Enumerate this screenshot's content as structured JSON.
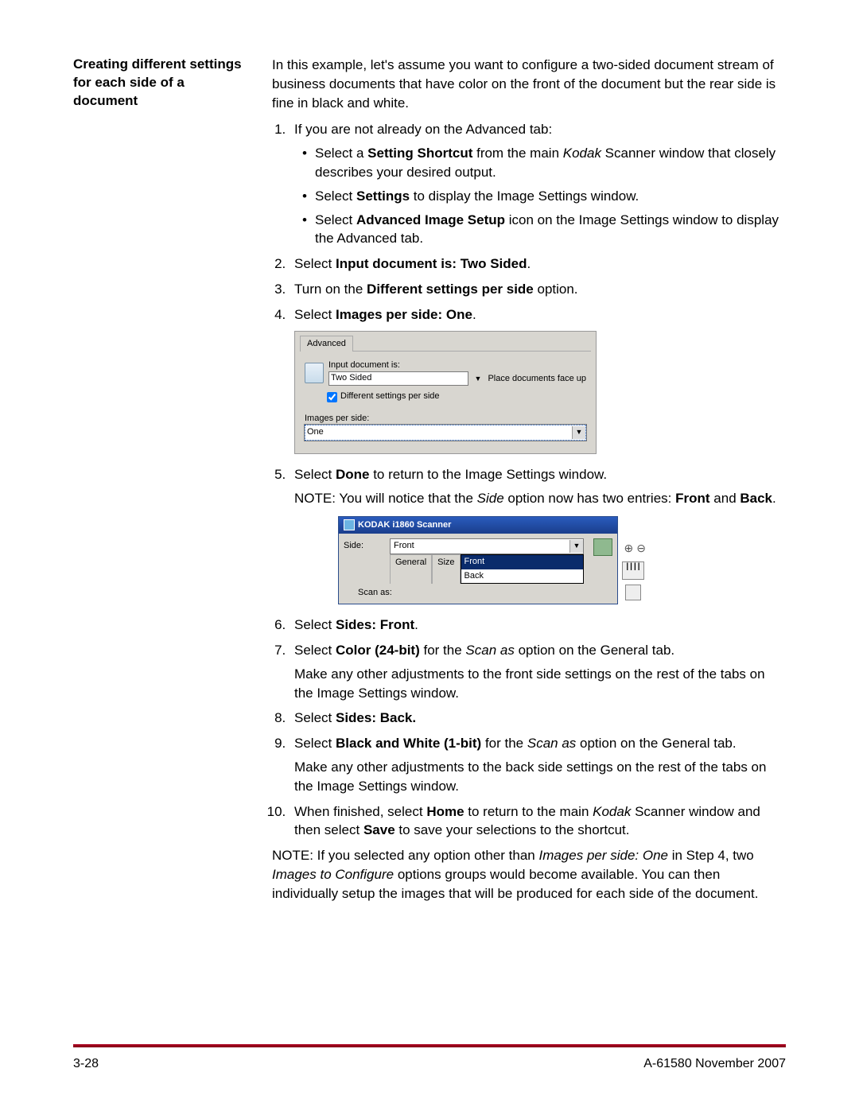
{
  "sidebar": {
    "heading": "Creating different settings for each side of a document"
  },
  "intro": "In this example, let's assume you want to configure a two-sided document stream of business documents that have color on the front of the document but the rear side is fine in black and white.",
  "step1_lead": "If you are not already on the Advanced tab:",
  "step1_bullets": {
    "b1_pre": "Select a ",
    "b1_bold": "Setting Shortcut",
    "b1_mid": " from the main ",
    "b1_it": "Kodak",
    "b1_post": " Scanner window that closely describes your desired output.",
    "b2_pre": "Select ",
    "b2_bold": "Settings",
    "b2_post": " to display the Image Settings window.",
    "b3_pre": "Select ",
    "b3_bold": "Advanced Image Setup",
    "b3_post": " icon on the Image Settings window to display the Advanced tab."
  },
  "step2_pre": "Select ",
  "step2_bold": "Input document is: Two Sided",
  "step2_post": ".",
  "step3_pre": "Turn on the ",
  "step3_bold": "Different settings per side",
  "step3_post": " option.",
  "step4_pre": "Select ",
  "step4_bold": "Images per side: One",
  "step4_post": ".",
  "fig1": {
    "tab": "Advanced",
    "input_doc_label": "Input document is:",
    "input_doc_value": "Two Sided",
    "place_label": "Place documents face up",
    "diff_label": "Different settings per side",
    "ips_label": "Images per side:",
    "ips_value": "One"
  },
  "step5_pre": "Select ",
  "step5_bold": "Done",
  "step5_post": " to return to the Image Settings window.",
  "note1_pre": "NOTE:  You will notice that the ",
  "note1_it": "Side",
  "note1_mid": " option now has two entries: ",
  "note1_bold1": "Front",
  "note1_and": " and ",
  "note1_bold2": "Back",
  "note1_post": ".",
  "fig2": {
    "title": "KODAK i1860 Scanner",
    "side_label": "Side:",
    "side_value": "Front",
    "drop_front": "Front",
    "drop_back": "Back",
    "tab_general": "General",
    "tab_size": "Size",
    "scan_as": "Scan as:"
  },
  "step6_pre": "Select ",
  "step6_bold": "Sides: Front",
  "step6_post": ".",
  "step7_pre": "Select ",
  "step7_bold": "Color (24-bit)",
  "step7_mid": " for the ",
  "step7_it": "Scan as",
  "step7_post": " option on the General tab.",
  "step7_p2": "Make any other adjustments to the front side settings on the rest of the tabs on the Image Settings window.",
  "step8_pre": "Select ",
  "step8_bold": "Sides: Back.",
  "step9_pre": "Select ",
  "step9_bold": "Black and White (1-bit)",
  "step9_mid": " for the ",
  "step9_it": "Scan as",
  "step9_post": " option on the General tab.",
  "step9_p2": "Make any other adjustments to the back side settings on the rest of the tabs on the Image Settings window.",
  "step10_pre": "When finished, select ",
  "step10_bold1": "Home",
  "step10_mid1": " to return to the main ",
  "step10_it": "Kodak",
  "step10_mid2": " Scanner window and then select ",
  "step10_bold2": "Save",
  "step10_post": " to save your selections to the shortcut.",
  "note2_pre": "NOTE: If you selected any option other than ",
  "note2_it1": "Images per side: One",
  "note2_mid1": " in Step 4, two ",
  "note2_it2": "Images to Configure",
  "note2_post": " options groups would become available. You can then individually setup the images that will be produced for each side of the document.",
  "footer": {
    "page": "3-28",
    "doc": "A-61580  November 2007"
  }
}
